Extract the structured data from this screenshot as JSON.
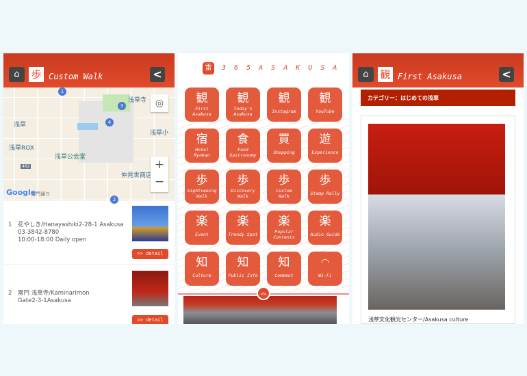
{
  "colors": {
    "brand": "#e24a2c",
    "category_bar": "#b32000",
    "background": "#eef8fb"
  },
  "left": {
    "title": "Custom Walk",
    "category_glyph": "歩",
    "map": {
      "labels": [
        "浅草寺",
        "浅草",
        "浅草ROX",
        "浅草公会堂",
        "浅草小",
        "仲見世商店街",
        "雷門通り",
        "462"
      ],
      "pins": [
        "1",
        "2",
        "3",
        "4"
      ],
      "google": "Google",
      "zoom_in": "+",
      "zoom_out": "−"
    },
    "items": [
      {
        "num": "1",
        "lines": [
          "花やしき/Hanayashiki2-28-1 Asakusa",
          "03-3842-8780",
          "10:00-18:00 Daily open"
        ],
        "detail": ">> detail"
      },
      {
        "num": "2",
        "lines": [
          "雷門 浅草寺/Kaminarimon",
          "Gate2-3-1Asakusa"
        ],
        "detail": ">> detail"
      }
    ]
  },
  "middle": {
    "logo": "3 6 5 A S A K U S A",
    "logo_glyph": "雷",
    "tiles": [
      {
        "icon": "観",
        "label": "First\nAsakusa"
      },
      {
        "icon": "観",
        "label": "Today's\nAsakusa"
      },
      {
        "icon": "観",
        "label": "Instagram"
      },
      {
        "icon": "観",
        "label": "YouTube"
      },
      {
        "icon": "宿",
        "label": "Hotel\nRyokan"
      },
      {
        "icon": "食",
        "label": "Food\nGastronomy"
      },
      {
        "icon": "買",
        "label": "Shopping"
      },
      {
        "icon": "遊",
        "label": "Experience"
      },
      {
        "icon": "歩",
        "label": "Sightseeing\nWalk"
      },
      {
        "icon": "歩",
        "label": "Discovery\nWalk"
      },
      {
        "icon": "歩",
        "label": "Custom\nWalk"
      },
      {
        "icon": "歩",
        "label": "Stamp Rally"
      },
      {
        "icon": "楽",
        "label": "Event"
      },
      {
        "icon": "楽",
        "label": "Trendy Spot"
      },
      {
        "icon": "楽",
        "label": "Popular\nContents"
      },
      {
        "icon": "楽",
        "label": "Audio Guide"
      },
      {
        "icon": "知",
        "label": "Culture"
      },
      {
        "icon": "知",
        "label": "Public Info"
      },
      {
        "icon": "知",
        "label": "Comment"
      },
      {
        "icon": "wifi-icon",
        "label": "Wi-Fi"
      }
    ],
    "collapse": "︽"
  },
  "right": {
    "title": "First Asakusa",
    "category_glyph": "観",
    "category": "カテゴリー：はじめての浅草",
    "caption": "浅草文化観光センター/Asakusa culture"
  }
}
